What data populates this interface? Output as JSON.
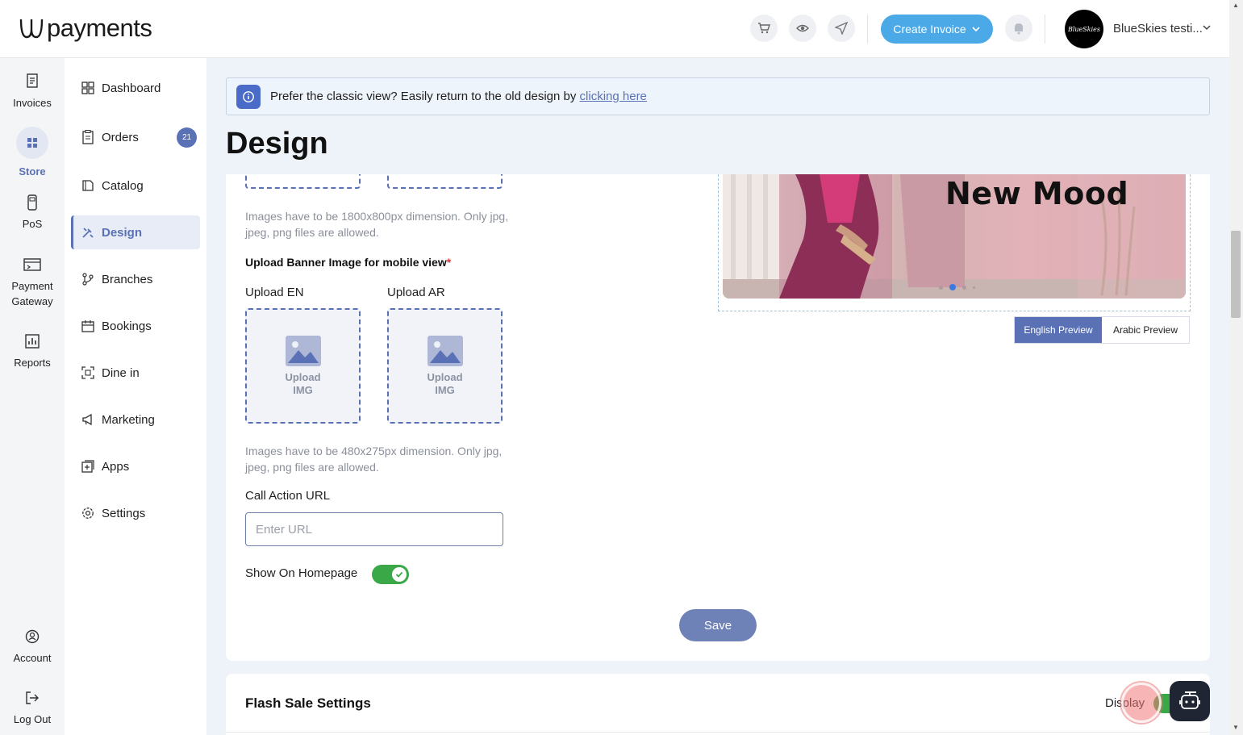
{
  "header": {
    "logo_text": "payments",
    "create_invoice_label": "Create Invoice",
    "avatar_text": "BlueSkies",
    "account_name": "BlueSkies testi..."
  },
  "rail": {
    "invoices": "Invoices",
    "store": "Store",
    "pos": "PoS",
    "payment_gateway": "Payment Gateway",
    "reports": "Reports",
    "account": "Account",
    "logout": "Log Out"
  },
  "nav": {
    "dashboard": "Dashboard",
    "orders": "Orders",
    "orders_badge": "21",
    "catalog": "Catalog",
    "design": "Design",
    "branches": "Branches",
    "bookings": "Bookings",
    "dine_in": "Dine in",
    "marketing": "Marketing",
    "apps": "Apps",
    "settings": "Settings"
  },
  "banner": {
    "text": "Prefer the classic view? Easily return to the old design by",
    "link": "clicking here"
  },
  "page_title": "Design",
  "form": {
    "desktop_hint": "Images have to be 1800x800px dimension. Only jpg, jpeg, png files are allowed.",
    "mobile_section_label": "Upload Banner Image for mobile view",
    "required_mark": "*",
    "upload_en_label": "Upload EN",
    "upload_ar_label": "Upload AR",
    "upload_img_line1": "Upload",
    "upload_img_line2": "IMG",
    "mobile_hint": "Images have to be 480x275px dimension. Only jpg, jpeg, png files are allowed.",
    "call_action_label": "Call Action URL",
    "url_placeholder": "Enter URL",
    "show_homepage_label": "Show On Homepage",
    "show_homepage_on": true,
    "save_label": "Save"
  },
  "preview": {
    "banner_text": "New Mood",
    "english_tab": "English Preview",
    "arabic_tab": "Arabic Preview",
    "active_slide": 2,
    "slide_count": 4
  },
  "flash_sale": {
    "title": "Flash Sale Settings",
    "display_label": "Display"
  },
  "colors": {
    "accent": "#5a72b5",
    "create_button": "#4aa9e6",
    "toggle_on": "#3aa847"
  }
}
